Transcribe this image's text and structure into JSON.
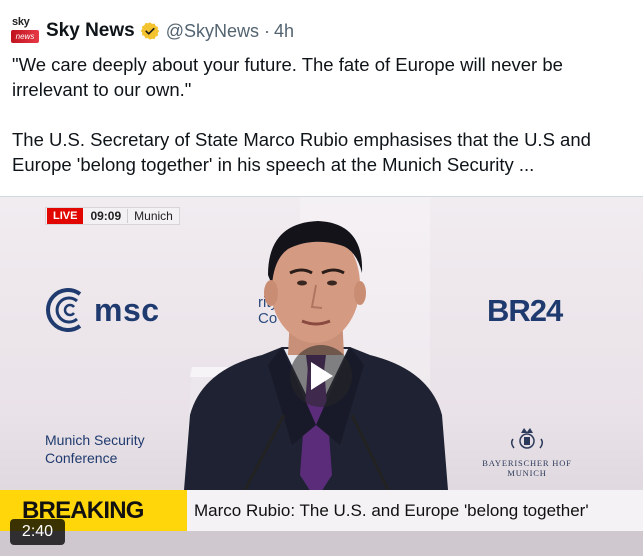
{
  "tweet": {
    "author_name": "Sky News",
    "handle": "@SkyNews",
    "separator": "·",
    "time": "4h",
    "avatar": {
      "top_text": "sky",
      "bottom_text": "news"
    },
    "verified_icon": "gold-checkmark-badge-icon",
    "text": "\"We care deeply about your future. The fate of Europe will never be irrelevant to our own.\"\n\nThe U.S. Secretary of State Marco Rubio emphasises that the U.S and Europe 'belong together' in his speech at the Munich Security ..."
  },
  "video": {
    "live_label": "LIVE",
    "clock": "09:09",
    "location": "Munich",
    "logos": {
      "msc": "msc",
      "msc_fragment": "rity\nCo",
      "br24": "BR24",
      "msc_caption": "Munich Security\nConference",
      "hotel": "BAYERISCHER HOF\nMUNICH"
    },
    "breaking_label": "BREAKING NEWS",
    "breaking_text": "Marco Rubio: The U.S. and Europe 'belong together'",
    "duration": "2:40",
    "play_icon": "play-icon"
  },
  "colors": {
    "verified": "#f4c430",
    "live": "#e10600",
    "breaking": "#ffd60a",
    "msc_blue": "#1f3a6e"
  }
}
